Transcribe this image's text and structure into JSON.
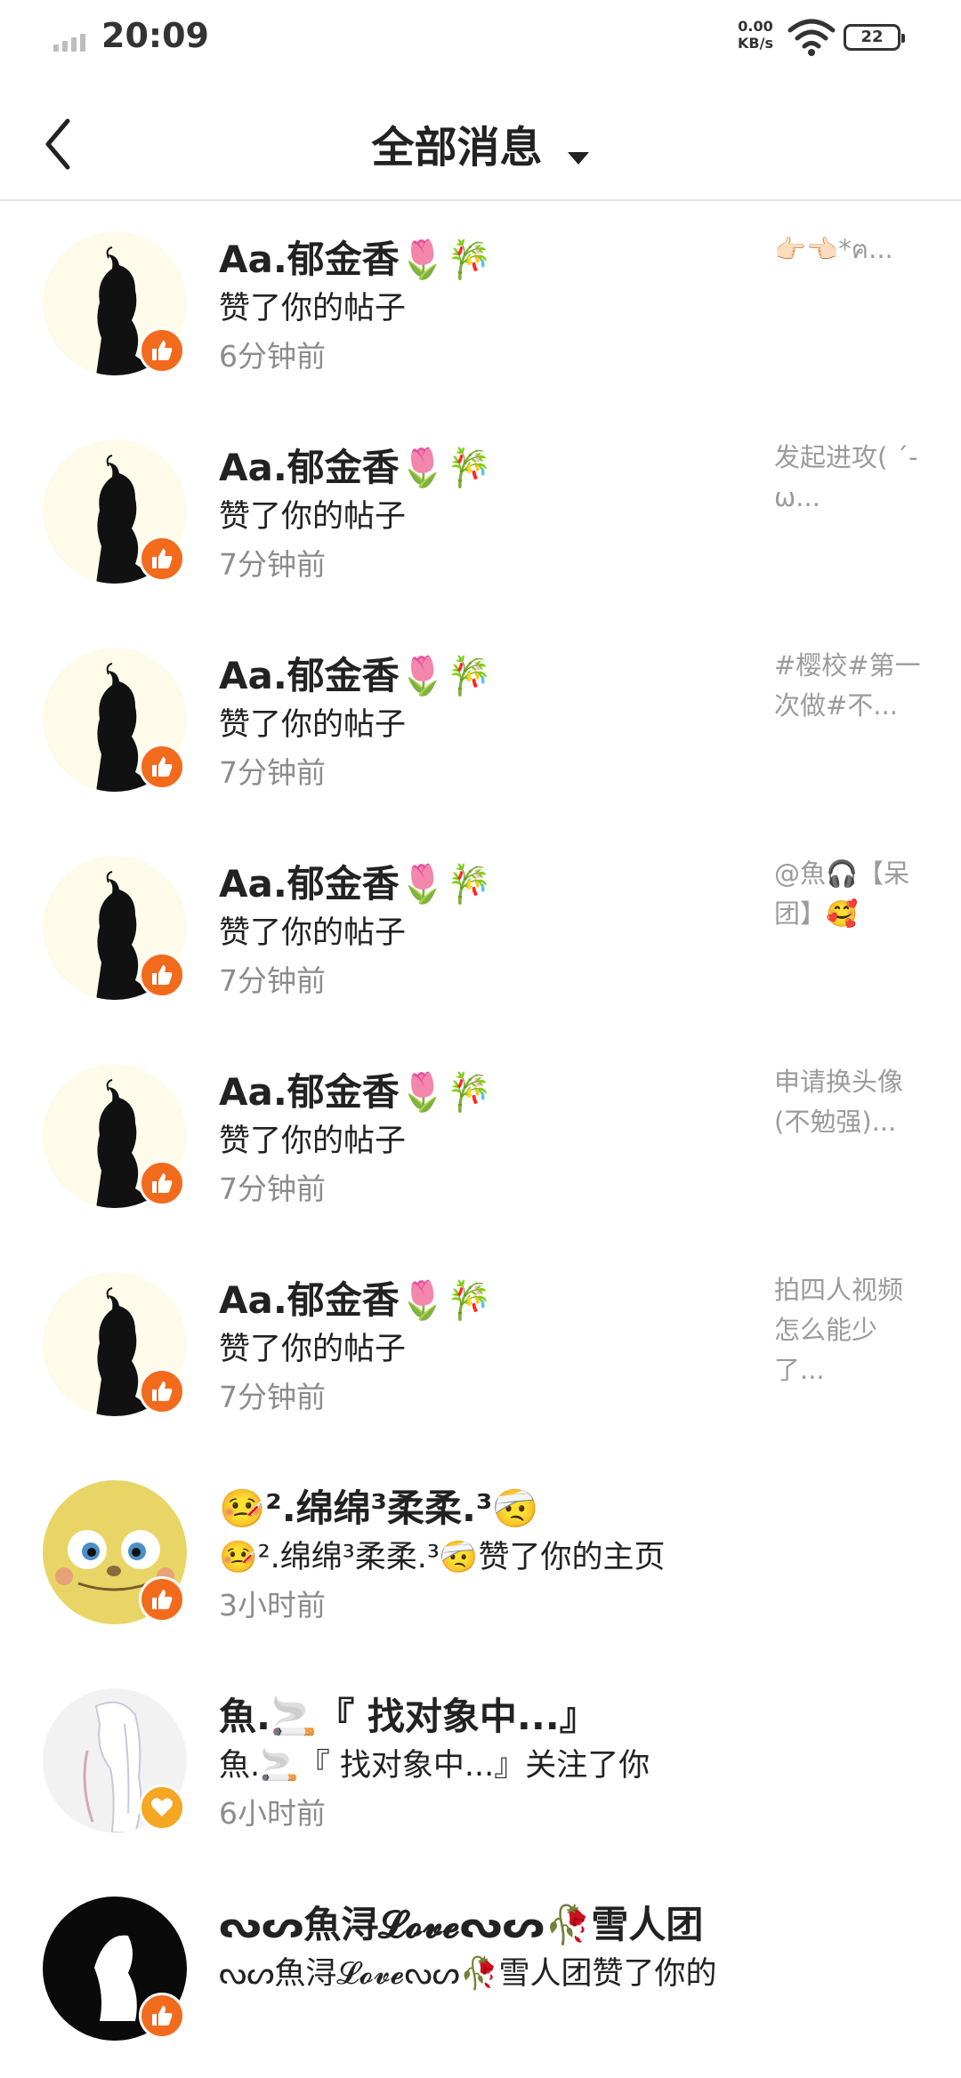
{
  "status_bar": {
    "time": "20:09",
    "net_speed_value": "0.00",
    "net_speed_unit": "KB/s",
    "battery": "22"
  },
  "header": {
    "title": "全部消息"
  },
  "colors": {
    "like_badge": "#f26b1d",
    "follow_badge": "#f5a623",
    "secondary_text": "#8c8c8c"
  },
  "messages": [
    {
      "name": "Aa.郁金香🌷🎋",
      "action": "赞了你的帖子",
      "time": "6分钟前",
      "preview": "👉🏻👈🏻*ฅ...",
      "badge_icon": "thumb-up-icon",
      "avatar": "silhouette-girl"
    },
    {
      "name": "Aa.郁金香🌷🎋",
      "action": "赞了你的帖子",
      "time": "7分钟前",
      "preview": "发起进攻( ´-ω...",
      "badge_icon": "thumb-up-icon",
      "avatar": "silhouette-girl"
    },
    {
      "name": "Aa.郁金香🌷🎋",
      "action": "赞了你的帖子",
      "time": "7分钟前",
      "preview": "#樱校#第一次做#不...",
      "badge_icon": "thumb-up-icon",
      "avatar": "silhouette-girl"
    },
    {
      "name": "Aa.郁金香🌷🎋",
      "action": "赞了你的帖子",
      "time": "7分钟前",
      "preview": "@魚🎧【呆团】🥰",
      "badge_icon": "thumb-up-icon",
      "avatar": "silhouette-girl"
    },
    {
      "name": "Aa.郁金香🌷🎋",
      "action": "赞了你的帖子",
      "time": "7分钟前",
      "preview": "申请换头像(不勉强)...",
      "badge_icon": "thumb-up-icon",
      "avatar": "silhouette-girl"
    },
    {
      "name": "Aa.郁金香🌷🎋",
      "action": "赞了你的帖子",
      "time": "7分钟前",
      "preview": "拍四人视频怎么能少了...",
      "badge_icon": "thumb-up-icon",
      "avatar": "silhouette-girl"
    },
    {
      "name": "🤒².绵绵³柔柔.³🤕",
      "action": "🤒².绵绵³柔柔.³🤕赞了你的主页",
      "time": "3小时前",
      "preview": "",
      "badge_icon": "thumb-up-icon",
      "avatar": "yellow-cartoon"
    },
    {
      "name": "魚.🚬『 找对象中...』",
      "action": "魚.🚬『 找对象中...』关注了你",
      "time": "6小时前",
      "preview": "",
      "badge_icon": "heart-icon",
      "avatar": "white-hair-anime"
    },
    {
      "name": "ᔓᔕ魚浔𝓛𝓸𝓿𝓮ᔓᔕ🥀雪人团",
      "action": "ᔓᔕ魚浔𝓛𝓸𝓿𝓮ᔓᔕ🥀雪人团赞了你的",
      "time": "",
      "preview": "",
      "badge_icon": "thumb-up-icon",
      "avatar": "black-avatar"
    }
  ]
}
